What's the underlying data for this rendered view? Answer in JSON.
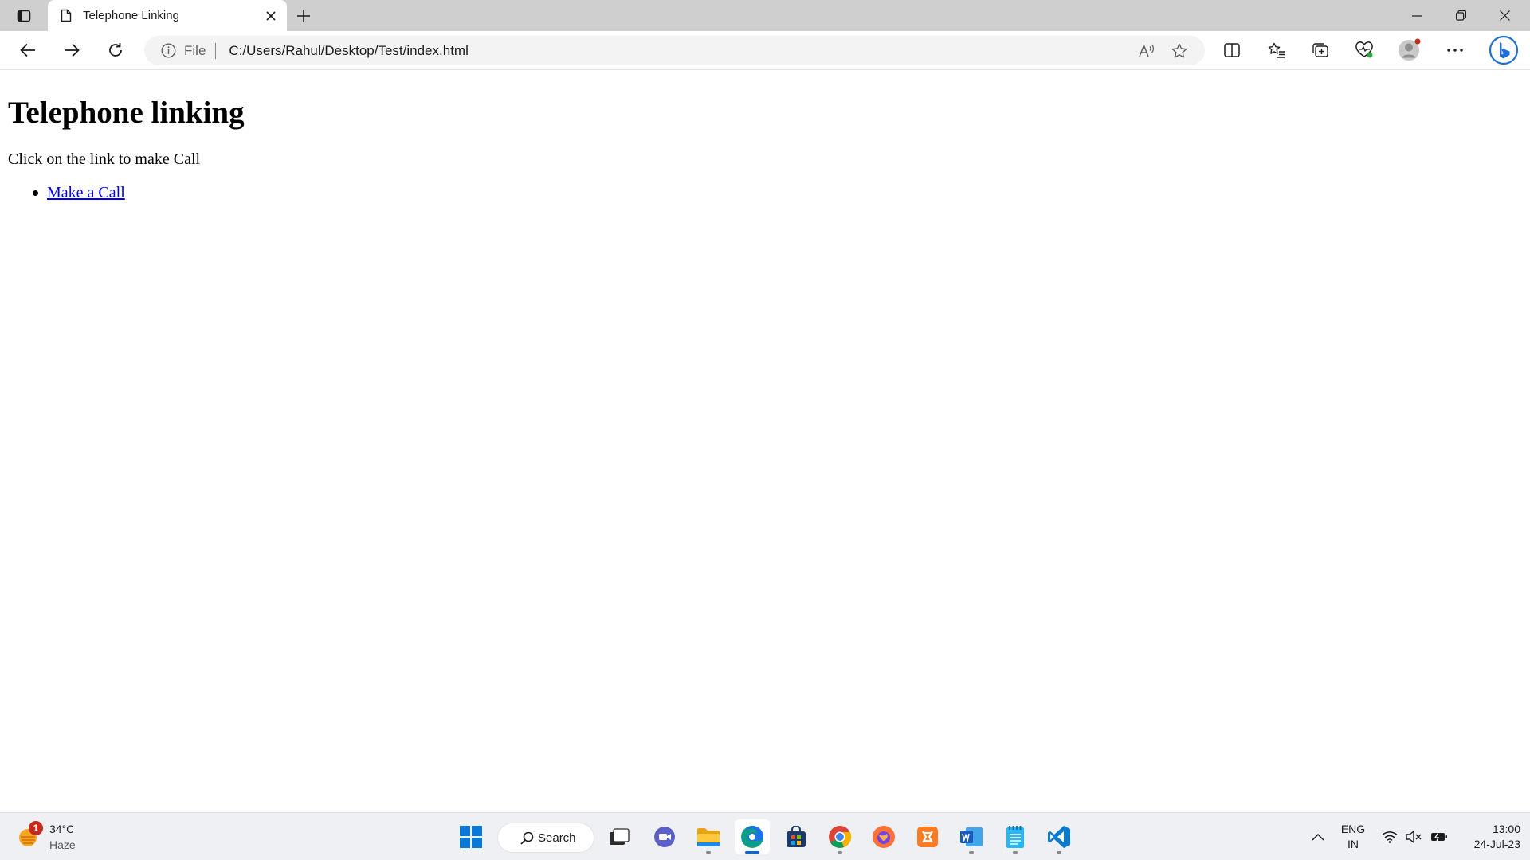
{
  "browser": {
    "tab": {
      "title": "Telephone Linking"
    },
    "address": {
      "scheme": "File",
      "url": "C:/Users/Rahul/Desktop/Test/index.html"
    }
  },
  "page": {
    "heading": "Telephone linking",
    "paragraph": "Click on the link to make Call",
    "list": [
      {
        "link_text": "Make a Call"
      }
    ]
  },
  "taskbar": {
    "weather": {
      "temperature": "34°C",
      "condition": "Haze",
      "badge": "1"
    },
    "search_label": "Search",
    "language": {
      "line1": "ENG",
      "line2": "IN"
    },
    "clock": {
      "time": "13:00",
      "date": "24-Jul-23"
    }
  },
  "colors": {
    "link": "#0000ee",
    "titlebar": "#cfcfcf",
    "taskbar": "#eef0f3",
    "edge_blue": "#0a66d8",
    "notification_badge": "#c42b1c"
  },
  "icons": {
    "browser": [
      "tab-actions-icon",
      "page-icon",
      "close-icon",
      "plus-icon",
      "minimize-icon",
      "restore-icon",
      "window-close-icon",
      "back-arrow-icon",
      "forward-arrow-icon",
      "reload-icon",
      "info-icon",
      "read-aloud-icon",
      "star-icon",
      "split-screen-icon",
      "favorites-icon",
      "collections-icon",
      "browser-essentials-icon",
      "profile-icon",
      "more-icon",
      "bing-copilot-icon"
    ],
    "taskbar": [
      "weather-icon",
      "windows-start-icon",
      "search-icon",
      "task-view-icon",
      "teams-chat-icon",
      "file-explorer-icon",
      "edge-icon",
      "store-icon",
      "chrome-icon",
      "firefox-icon",
      "xampp-icon",
      "word-icon",
      "notepad-icon",
      "vscode-icon",
      "show-hidden-icons-chevron-icon",
      "wifi-icon",
      "volume-muted-icon",
      "battery-icon"
    ]
  }
}
